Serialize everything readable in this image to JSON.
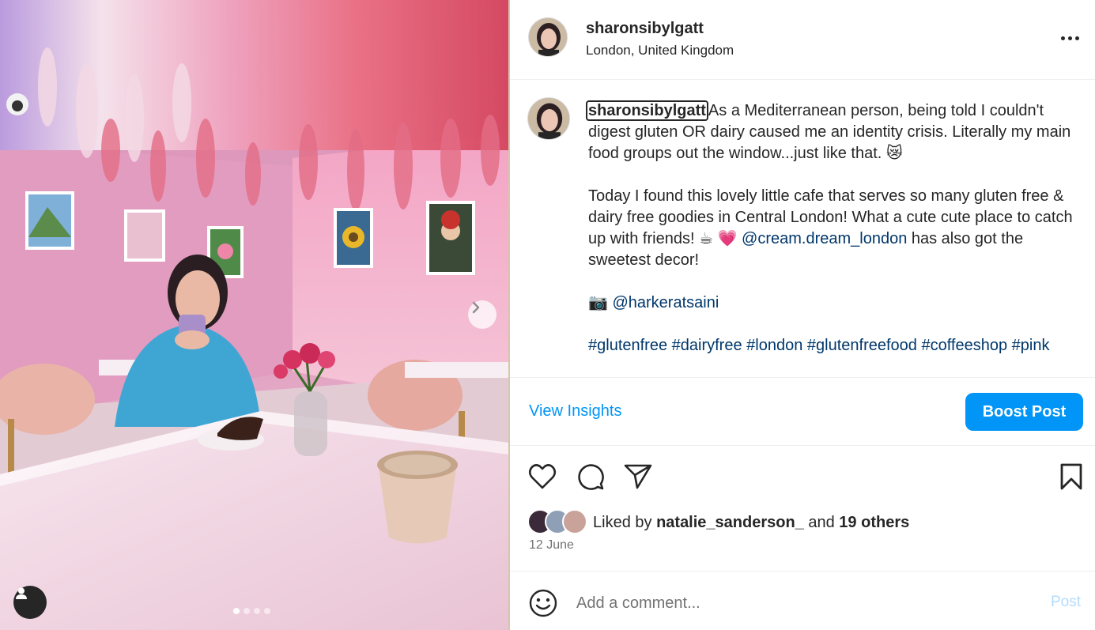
{
  "header": {
    "username": "sharonsibylgatt",
    "location": "London, United Kingdom",
    "avatar_icon": "profile-photo",
    "more_icon": "more-horizontal-icon"
  },
  "caption": {
    "username": "sharonsibylgatt",
    "paragraph1": "As a Mediterranean person, being told I couldn't digest gluten OR dairy caused me an identity crisis. Literally my main food groups out the window...just like that. 😿",
    "paragraph2_before": "Today I found this lovely little cafe that serves so many gluten free & dairy free goodies in Central London! What a cute cute place to catch up with friends! ☕ 💗 ",
    "paragraph2_mention": "@cream.dream_london",
    "paragraph2_after": " has also got the sweetest decor!",
    "camera_emoji": "📷",
    "photo_credit": "@harkeratsaini",
    "hashtags": [
      "#glutenfree",
      "#dairyfree",
      "#london",
      "#glutenfreefood",
      "#coffeeshop",
      "#pink"
    ]
  },
  "actions": {
    "view_insights": "View Insights",
    "boost_post": "Boost Post",
    "icons": [
      "heart-icon",
      "comment-icon",
      "share-icon",
      "bookmark-icon"
    ]
  },
  "likes": {
    "prefix": "Liked by ",
    "user": "natalie_sanderson_",
    "middle": " and ",
    "others": "19 others"
  },
  "date": "12 June",
  "comment": {
    "placeholder": "Add a comment...",
    "post_label": "Post"
  },
  "carousel": {
    "total_slides": 4,
    "active_slide": 1
  },
  "colors": {
    "accent": "#0095f6",
    "link": "#00376b",
    "text": "#262626",
    "muted": "#737373",
    "post_disabled": "#b3dbff"
  }
}
